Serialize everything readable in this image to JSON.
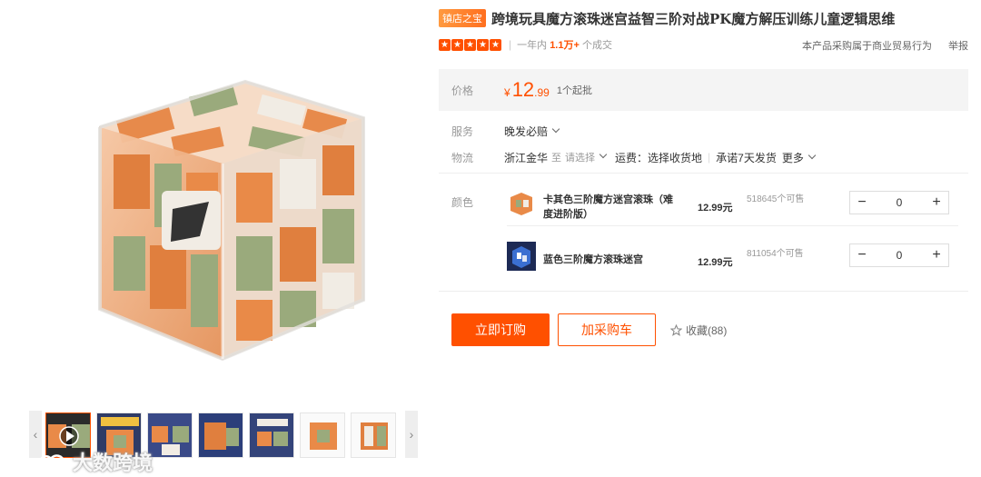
{
  "gallery": {
    "thumb_count": 7,
    "watermark_text": "大数跨境"
  },
  "product": {
    "store_badge": "镇店之宝",
    "title": "跨境玩具魔方滚珠迷宫益智三阶对战PK魔方解压训练儿童逻辑思维",
    "rating_stars": 5,
    "sales_prefix": "一年内",
    "sales_value": "1.1万+",
    "sales_suffix": "个成交",
    "trade_note": "本产品采购属于商业贸易行为",
    "report_label": "举报"
  },
  "price": {
    "label": "价格",
    "currency": "¥",
    "integer": "12",
    "decimal": ".99",
    "min_order": "1个起批"
  },
  "service": {
    "label": "服务",
    "value": "晚发必赔"
  },
  "logistics": {
    "label": "物流",
    "origin": "浙江金华",
    "to": "至",
    "destination": "请选择",
    "freight": "运费：选择收货地",
    "promise": "承诺7天发货",
    "more": "更多"
  },
  "colors": {
    "label": "颜色",
    "variants": [
      {
        "name": "卡其色三阶魔方迷宫滚珠（难度进阶版）",
        "price": "12.99元",
        "stock": "518645个可售",
        "qty": "0",
        "minus": "−",
        "plus": "+"
      },
      {
        "name": "蓝色三阶魔方滚珠迷宫",
        "price": "12.99元",
        "stock": "811054个可售",
        "qty": "0",
        "minus": "−",
        "plus": "+"
      }
    ]
  },
  "actions": {
    "buy_label": "立即订购",
    "cart_label": "加采购车",
    "favorite_label": "收藏(88)"
  },
  "colors_theme": {
    "accent": "#ff5000",
    "badge": "#ff7a2a"
  }
}
